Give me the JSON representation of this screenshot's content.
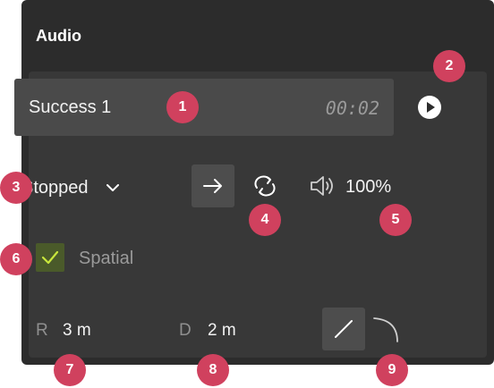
{
  "panel": {
    "title": "Audio"
  },
  "clip": {
    "name": "Success 1",
    "duration": "00:02"
  },
  "playback": {
    "state": "Stopped",
    "volume": "100%"
  },
  "spatial": {
    "label": "Spatial",
    "checked": true
  },
  "distance": {
    "r_label": "R",
    "r_value": "3 m",
    "d_label": "D",
    "d_value": "2 m"
  },
  "markers": [
    "1",
    "2",
    "3",
    "4",
    "5",
    "6",
    "7",
    "8",
    "9"
  ],
  "colors": {
    "panel_bg": "#2c2c2c",
    "marker": "#d0415e",
    "check": "#c8e63c"
  },
  "icons": [
    "play-icon",
    "chevron-down-icon",
    "arrow-right-icon",
    "loop-icon",
    "speaker-icon",
    "checkmark-icon",
    "linear-rolloff-icon",
    "curve-rolloff-icon"
  ]
}
